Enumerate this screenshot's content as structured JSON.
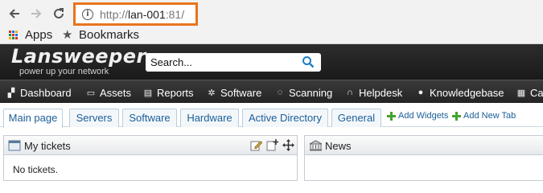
{
  "browser": {
    "url_protocol": "http://",
    "url_host": "lan-001",
    "url_port": ":81/",
    "info_icon": "info-icon"
  },
  "bookmarks": {
    "apps_label": "Apps",
    "bookmarks_label": "Bookmarks"
  },
  "header": {
    "logo": "Lansweeper",
    "tagline": "power up your network",
    "search_placeholder": "Search..."
  },
  "menu": {
    "items": [
      {
        "label": "Dashboard"
      },
      {
        "label": "Assets"
      },
      {
        "label": "Reports"
      },
      {
        "label": "Software"
      },
      {
        "label": "Scanning"
      },
      {
        "label": "Helpdesk"
      },
      {
        "label": "Knowledgebase"
      },
      {
        "label": "Ca"
      }
    ]
  },
  "tabs": {
    "items": [
      {
        "label": "Main page"
      },
      {
        "label": "Servers"
      },
      {
        "label": "Software"
      },
      {
        "label": "Hardware"
      },
      {
        "label": "Active Directory"
      },
      {
        "label": "General"
      }
    ],
    "add_widgets": "Add Widgets",
    "add_new_tab": "Add New Tab"
  },
  "widgets": {
    "tickets_title": "My tickets",
    "tickets_body": "No tickets.",
    "news_title": "News"
  },
  "colors": {
    "highlight_border": "#e8741e",
    "tab_text": "#1b5e98",
    "add_icon": "#45a32e"
  }
}
